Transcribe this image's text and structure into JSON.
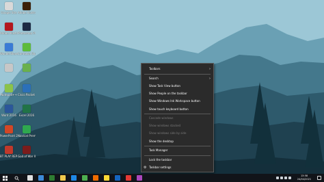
{
  "desktop_icons": [
    {
      "label": "Google Site",
      "color": "#d9d9d9"
    },
    {
      "label": "Adobe Illustrator",
      "color": "#3b1f08"
    },
    {
      "label": "Adobe Illustrator",
      "color": "#b3171e"
    },
    {
      "label": "Photoshop Premium",
      "color": "#1c2a44"
    },
    {
      "label": "WonderShare Filmora",
      "color": "#3a7bd5"
    },
    {
      "label": "Camtasia Studio",
      "color": "#5dbb3a"
    },
    {
      "label": "",
      "color": "#c7c7c7"
    },
    {
      "label": "",
      "color": "#6ab04c"
    },
    {
      "label": "Notepad++",
      "color": "#8bc34a"
    },
    {
      "label": "Cisco Packet Tracer",
      "color": "#2b70b9"
    },
    {
      "label": "Word 2016",
      "color": "#2b579a"
    },
    {
      "label": "Excel 2016",
      "color": "#217346"
    },
    {
      "label": "PowerPoint 2016",
      "color": "#d24726"
    },
    {
      "label": "Navicat Premium 12",
      "color": "#2fa84f"
    },
    {
      "label": "BT PLAY REP OFFLINE",
      "color": "#c0392b"
    },
    {
      "label": "God of War II",
      "color": "#7a1c1c"
    }
  ],
  "context_menu": {
    "items": [
      {
        "label": "Toolbars",
        "has_submenu": true,
        "disabled": false
      },
      {
        "label": "Search",
        "has_submenu": true,
        "disabled": false
      },
      {
        "label": "Show Task View button",
        "has_submenu": false,
        "disabled": false
      },
      {
        "label": "Show People on the taskbar",
        "has_submenu": false,
        "disabled": false
      },
      {
        "label": "Show Windows Ink Workspace button",
        "has_submenu": false,
        "disabled": false
      },
      {
        "label": "Show touch keyboard button",
        "has_submenu": false,
        "disabled": false
      },
      {
        "label": "Cascade windows",
        "has_submenu": false,
        "disabled": true
      },
      {
        "label": "Show windows stacked",
        "has_submenu": false,
        "disabled": true
      },
      {
        "label": "Show windows side by side",
        "has_submenu": false,
        "disabled": true
      },
      {
        "label": "Show the desktop",
        "has_submenu": false,
        "disabled": false
      },
      {
        "label": "Task Manager",
        "has_submenu": false,
        "disabled": false
      },
      {
        "label": "Lock the taskbar",
        "has_submenu": false,
        "disabled": false
      },
      {
        "label": "Taskbar settings",
        "has_submenu": false,
        "disabled": false,
        "icon": "gear-icon"
      }
    ]
  },
  "taskbar": {
    "start_icon": "windows-logo-icon",
    "search_icon": "search-icon",
    "pinned": [
      {
        "name": "task-view-icon",
        "color": "#e0e0e0"
      },
      {
        "name": "microsoft-store-icon",
        "color": "#3c8ad8"
      },
      {
        "name": "game-app-icon",
        "color": "#2e7d32"
      },
      {
        "name": "file-explorer-icon",
        "color": "#f2c94c"
      },
      {
        "name": "vscode-icon",
        "color": "#1e88e5"
      },
      {
        "name": "chrome-icon",
        "color": "#4caf50"
      },
      {
        "name": "sublime-icon",
        "color": "#ef6c00"
      },
      {
        "name": "app-icon",
        "color": "#fdd835"
      },
      {
        "name": "photoshop-icon",
        "color": "#1565c0"
      },
      {
        "name": "app-icon-2",
        "color": "#e53935"
      },
      {
        "name": "app-icon-3",
        "color": "#ab47bc"
      }
    ],
    "clock_time": "13:58",
    "clock_date": "24/04/2021"
  }
}
